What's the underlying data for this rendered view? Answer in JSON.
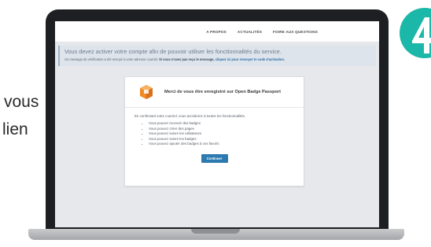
{
  "slide": {
    "line1": "vous",
    "line2": "lien"
  },
  "nav": {
    "items": [
      {
        "label": "A PROPOS"
      },
      {
        "label": "ACTUALITÉS"
      },
      {
        "label": "FOIRE AUX QUESTIONS"
      }
    ]
  },
  "alert": {
    "title": "Vous devez activer votre compte afin de pouvoir utiliser les fonctionnalités du service.",
    "message_prefix": "Un message de vérification a été envoyé à votre adresse courriel.",
    "message_bold": "Si vous n'avez pas reçu le message, cliquez ici pour renvoyer le code d'activation.",
    "message_bold_a": "Si vous n'avez pas reçu le message,",
    "message_link": "cliquez ici pour renvoyer le code d'activation."
  },
  "card": {
    "title": "Merci de vous être enregistré sur Open Badge Passport",
    "intro": "En confirmant votre courriel, vous accéderez à toutes les fonctionnalités.",
    "features": [
      "Vous pouvez recevoir des badges",
      "Vous pouvez créer des pages",
      "Vous pouvez suivre les utilisateurs",
      "Vous pouvez suivre les badges",
      "Vous pouvez ajouter des badges à vos favoris"
    ],
    "continue_label": "Continuer"
  },
  "colors": {
    "accent": "#2c7ab0",
    "badge_orange": "#f08a24",
    "brand_teal": "#1bb7a8"
  }
}
